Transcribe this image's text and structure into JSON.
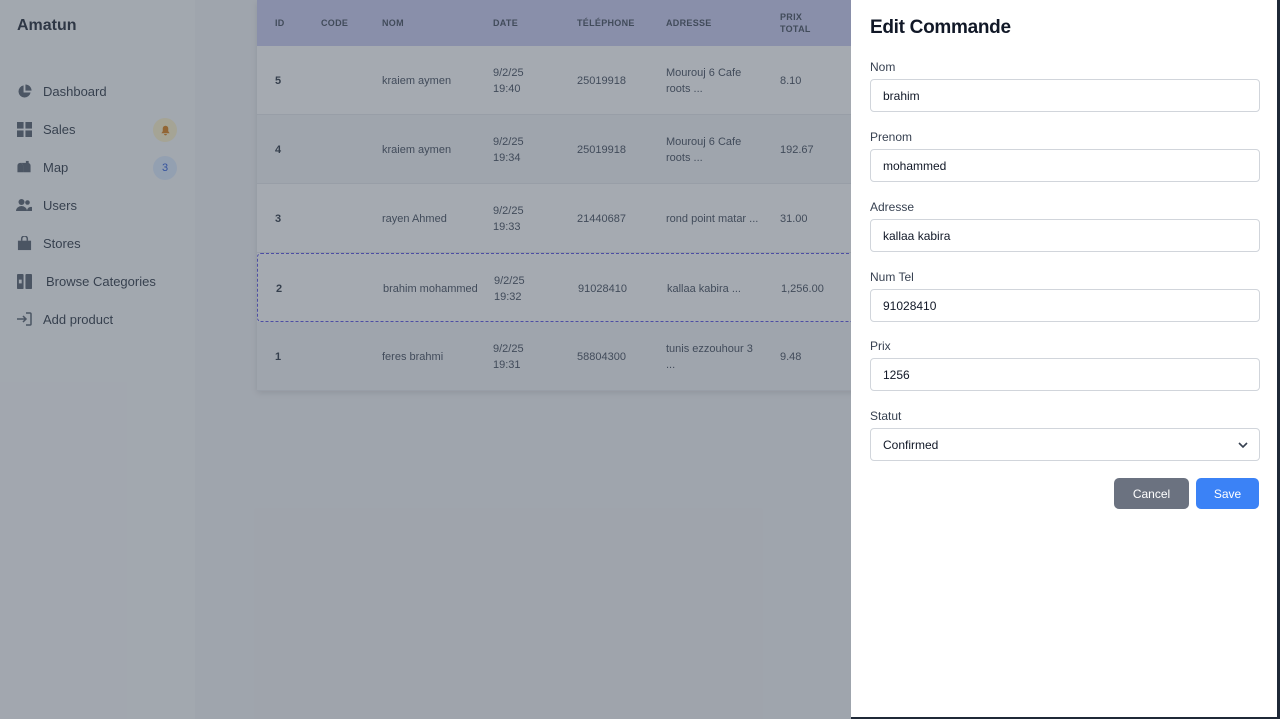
{
  "app": {
    "brand": "Amatun"
  },
  "sidebar": {
    "items": [
      {
        "label": "Dashboard",
        "icon": "pie-chart-icon"
      },
      {
        "label": "Sales",
        "icon": "grid-icon",
        "badge_icon": "bell-icon"
      },
      {
        "label": "Map",
        "icon": "mailbox-icon",
        "badge": "3"
      },
      {
        "label": "Users",
        "icon": "users-icon"
      },
      {
        "label": "Stores",
        "icon": "shopping-bag-icon"
      },
      {
        "label": "Browse Categories",
        "icon": "columns-icon"
      },
      {
        "label": "Add product",
        "icon": "sign-in-icon"
      }
    ]
  },
  "table": {
    "headers": {
      "id": "ID",
      "code": "CODE",
      "nom": "NOM",
      "date": "DATE",
      "tel": "TÉLÉPHONE",
      "adresse": "ADRESSE",
      "prix": "PRIX TOTAL"
    },
    "rows": [
      {
        "id": "5",
        "code": "",
        "nom": "kraiem aymen",
        "date": "9/2/25 19:40",
        "tel": "25019918",
        "adresse": "Mourouj 6 Cafe roots ...",
        "prix": "8.10"
      },
      {
        "id": "4",
        "code": "",
        "nom": "kraiem aymen",
        "date": "9/2/25 19:34",
        "tel": "25019918",
        "adresse": "Mourouj 6 Cafe roots ...",
        "prix": "192.67"
      },
      {
        "id": "3",
        "code": "",
        "nom": "rayen Ahmed",
        "date": "9/2/25 19:33",
        "tel": "21440687",
        "adresse": "rond point matar ...",
        "prix": "31.00"
      },
      {
        "id": "2",
        "code": "",
        "nom": "brahim mohammed",
        "date": "9/2/25 19:32",
        "tel": "91028410",
        "adresse": "kallaa kabira ...",
        "prix": "1,256.00"
      },
      {
        "id": "1",
        "code": "",
        "nom": "feres brahmi",
        "date": "9/2/25 19:31",
        "tel": "58804300",
        "adresse": "tunis ezzouhour 3 ...",
        "prix": "9.48"
      }
    ]
  },
  "drawer": {
    "title": "Edit Commande",
    "fields": {
      "nom": {
        "label": "Nom",
        "value": "brahim"
      },
      "prenom": {
        "label": "Prenom",
        "value": "mohammed"
      },
      "adresse": {
        "label": "Adresse",
        "value": "kallaa kabira"
      },
      "numtel": {
        "label": "Num Tel",
        "value": "91028410"
      },
      "prix": {
        "label": "Prix",
        "value": "1256"
      },
      "statut": {
        "label": "Statut",
        "value": "Confirmed"
      }
    },
    "cancel_label": "Cancel",
    "save_label": "Save"
  },
  "colors": {
    "primary": "#3b82f6",
    "secondary": "#6b7280",
    "table_header": "#c7c8f0",
    "selection": "#4f46e5"
  }
}
